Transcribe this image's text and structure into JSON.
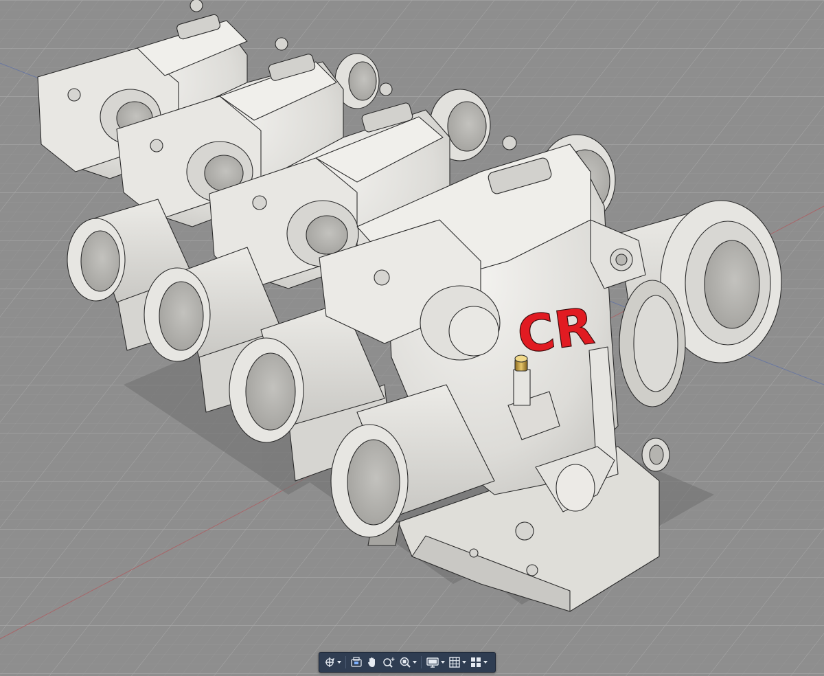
{
  "viewport": {
    "model_label": "CR",
    "background_color": "#8e8e8e",
    "grid_color": "#a7a7a7",
    "model_color": "#e4e3df",
    "accent_color": "#e11b22"
  },
  "navigation_bar": {
    "tools": [
      {
        "name": "orbit",
        "icon": "orbit-icon",
        "has_menu": true
      },
      {
        "name": "look-at",
        "icon": "look-at-icon",
        "has_menu": false
      },
      {
        "name": "pan",
        "icon": "pan-hand-icon",
        "has_menu": false
      },
      {
        "name": "zoom",
        "icon": "zoom-icon",
        "has_menu": false
      },
      {
        "name": "fit",
        "icon": "zoom-window-icon",
        "has_menu": true
      },
      {
        "name": "display-settings",
        "icon": "display-settings-icon",
        "has_menu": true
      },
      {
        "name": "grid-and-snaps",
        "icon": "grid-icon",
        "has_menu": true
      },
      {
        "name": "viewports",
        "icon": "viewports-icon",
        "has_menu": true
      }
    ]
  }
}
